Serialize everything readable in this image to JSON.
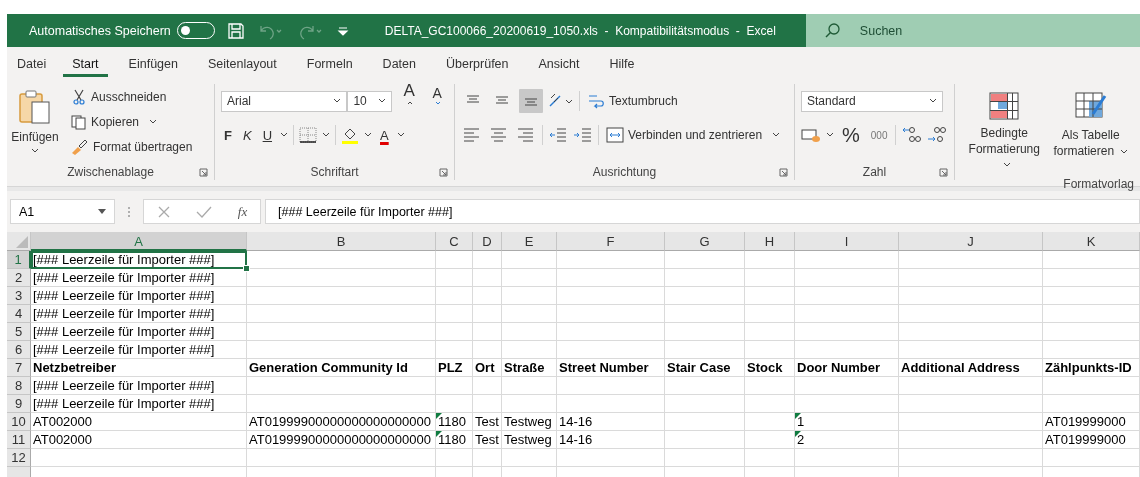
{
  "title_bar": {
    "autosave": {
      "label": "Automatisches Speichern",
      "on": false
    },
    "title": "DELTA_GC100066_20200619_1050.xls  -  Kompatibilitätsmodus  -  Excel",
    "search": {
      "placeholder": "Suchen"
    }
  },
  "tabs": [
    {
      "label": "Datei",
      "selected": false
    },
    {
      "label": "Start",
      "selected": true
    },
    {
      "label": "Einfügen",
      "selected": false
    },
    {
      "label": "Seitenlayout",
      "selected": false
    },
    {
      "label": "Formeln",
      "selected": false
    },
    {
      "label": "Daten",
      "selected": false
    },
    {
      "label": "Überprüfen",
      "selected": false
    },
    {
      "label": "Ansicht",
      "selected": false
    },
    {
      "label": "Hilfe",
      "selected": false
    }
  ],
  "ribbon": {
    "clipboard": {
      "label": "Zwischenablage",
      "paste": "Einfügen",
      "cut": "Ausschneiden",
      "copy": "Kopieren",
      "format_painter": "Format übertragen"
    },
    "font": {
      "label": "Schriftart",
      "font_name": "Arial",
      "font_size": "10",
      "grow": "A",
      "shrink": "A",
      "bold": "F",
      "italic": "K",
      "underline": "U",
      "font_color": "A"
    },
    "alignment": {
      "label": "Ausrichtung",
      "vertical": [
        {
          "kind": "top",
          "selected": false
        },
        {
          "kind": "middle",
          "selected": false
        },
        {
          "kind": "bottom",
          "selected": true
        }
      ],
      "wrap_text": "Textumbruch",
      "merge_center": "Verbinden und zentrieren"
    },
    "number": {
      "label": "Zahl",
      "format": "Standard",
      "percent": "%",
      "thousands": "000"
    },
    "styles": {
      "label": "Formatvorlag",
      "conditional": "Bedingte Formatierung",
      "as_table": "Als Tabelle formatieren"
    }
  },
  "formula_bar": {
    "name_box": "A1",
    "function_label": "fx",
    "value": "[### Leerzeile für Importer ###]"
  },
  "sheet": {
    "columns": [
      {
        "label": "A",
        "selected": true
      },
      {
        "label": "B",
        "selected": false
      },
      {
        "label": "C",
        "selected": false
      },
      {
        "label": "D",
        "selected": false
      },
      {
        "label": "E",
        "selected": false
      },
      {
        "label": "F",
        "selected": false
      },
      {
        "label": "G",
        "selected": false
      },
      {
        "label": "H",
        "selected": false
      },
      {
        "label": "I",
        "selected": false
      },
      {
        "label": "J",
        "selected": false
      },
      {
        "label": "K",
        "selected": false
      }
    ],
    "rows": [
      {
        "number": "1",
        "selected": true,
        "bold": false,
        "cells": {
          "A": {
            "text": "[### Leerzeile für Importer ###]"
          }
        }
      },
      {
        "number": "2",
        "selected": false,
        "bold": false,
        "cells": {
          "A": {
            "text": "[### Leerzeile für Importer ###]"
          }
        }
      },
      {
        "number": "3",
        "selected": false,
        "bold": false,
        "cells": {
          "A": {
            "text": "[### Leerzeile für Importer ###]"
          }
        }
      },
      {
        "number": "4",
        "selected": false,
        "bold": false,
        "cells": {
          "A": {
            "text": "[### Leerzeile für Importer ###]"
          }
        }
      },
      {
        "number": "5",
        "selected": false,
        "bold": false,
        "cells": {
          "A": {
            "text": "[### Leerzeile für Importer ###]"
          }
        }
      },
      {
        "number": "6",
        "selected": false,
        "bold": false,
        "cells": {
          "A": {
            "text": "[### Leerzeile für Importer ###]"
          }
        }
      },
      {
        "number": "7",
        "selected": false,
        "bold": true,
        "cells": {
          "A": {
            "text": "Netzbetreiber"
          },
          "B": {
            "text": "Generation Community Id"
          },
          "C": {
            "text": "PLZ"
          },
          "D": {
            "text": "Ort"
          },
          "E": {
            "text": "Straße"
          },
          "F": {
            "text": "Street Number"
          },
          "G": {
            "text": "Stair Case"
          },
          "H": {
            "text": "Stock"
          },
          "I": {
            "text": "Door Number"
          },
          "J": {
            "text": "Additional Address"
          },
          "K": {
            "text": "Zählpunkts-ID"
          }
        }
      },
      {
        "number": "8",
        "selected": false,
        "bold": false,
        "cells": {
          "A": {
            "text": "[### Leerzeile für Importer ###]"
          }
        }
      },
      {
        "number": "9",
        "selected": false,
        "bold": false,
        "cells": {
          "A": {
            "text": "[### Leerzeile für Importer ###]"
          }
        }
      },
      {
        "number": "10",
        "selected": false,
        "bold": false,
        "cells": {
          "A": {
            "text": "AT002000",
            "flagged": false
          },
          "B": {
            "text": "AT01999900000000000000000",
            "flagged": false
          },
          "C": {
            "text": "1180",
            "flagged": true
          },
          "D": {
            "text": "Test",
            "flagged": false
          },
          "E": {
            "text": "Testweg",
            "flagged": false
          },
          "F": {
            "text": "14-16",
            "flagged": false
          },
          "I": {
            "text": "1",
            "flagged": true
          },
          "K": {
            "text": "AT019999000",
            "flagged": false
          }
        }
      },
      {
        "number": "11",
        "selected": false,
        "bold": false,
        "cells": {
          "A": {
            "text": "AT002000",
            "flagged": false
          },
          "B": {
            "text": "AT01999900000000000000000",
            "flagged": false
          },
          "C": {
            "text": "1180",
            "flagged": true
          },
          "D": {
            "text": "Test",
            "flagged": false
          },
          "E": {
            "text": "Testweg",
            "flagged": false
          },
          "F": {
            "text": "14-16",
            "flagged": false
          },
          "I": {
            "text": "2",
            "flagged": true
          },
          "K": {
            "text": "AT019999000",
            "flagged": false
          }
        }
      },
      {
        "number": "12",
        "selected": false
      }
    ]
  }
}
